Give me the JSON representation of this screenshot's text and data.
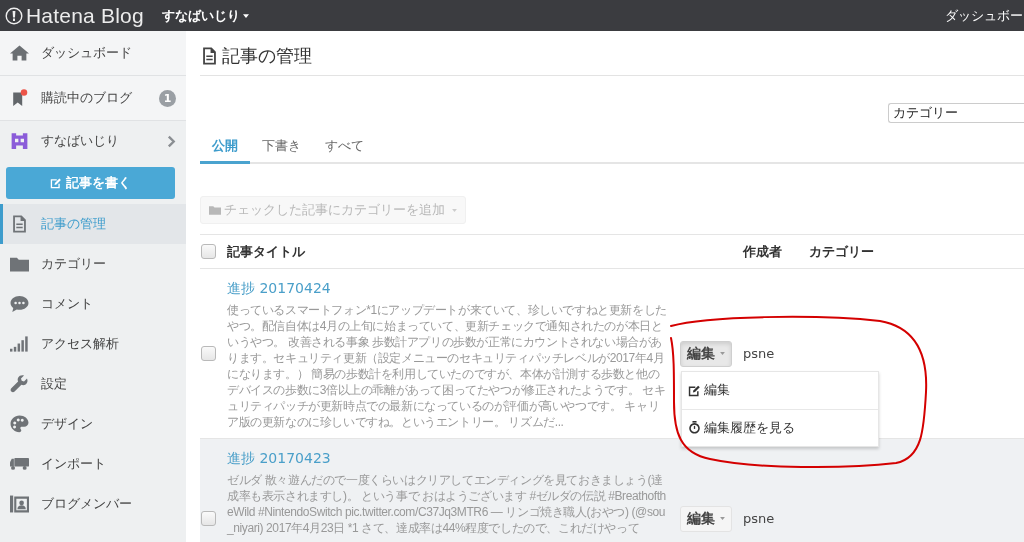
{
  "top_bar": {
    "logo": "Hatena Blog",
    "blog_menu": "すなばいじり",
    "right_link": "ダッシュボー"
  },
  "sidebar": {
    "top_items": [
      {
        "kind": "link",
        "label": "ダッシュボード",
        "unread": false
      },
      {
        "kind": "link",
        "label": "購読中のブログ",
        "badge": "1",
        "unread": true
      },
      {
        "kind": "submenu",
        "label": "すなばいじり",
        "unread": false
      }
    ],
    "write_button": {
      "label": "記事を書く"
    },
    "nav_items": [
      {
        "label": "記事の管理",
        "selected": true
      },
      {
        "label": "カテゴリー",
        "selected": false
      },
      {
        "label": "コメント",
        "selected": false
      },
      {
        "label": "アクセス解析",
        "selected": false
      },
      {
        "label": "設定",
        "selected": false
      },
      {
        "label": "デザイン",
        "selected": false
      },
      {
        "label": "インポート",
        "selected": false
      },
      {
        "label": "ブログメンバー",
        "selected": false
      }
    ]
  },
  "page": {
    "title": "記事の管理",
    "category_filter": {
      "value": "カテゴリー"
    },
    "tabs": [
      {
        "label": "公開",
        "selected": true
      },
      {
        "label": "下書き",
        "selected": false
      },
      {
        "label": "すべて",
        "selected": false
      }
    ],
    "bulk_button": {
      "label": "チェックした記事にカテゴリーを追加",
      "disabled": true
    },
    "table": {
      "select_all": {
        "checked": false
      },
      "columns": [
        "記事タイトル",
        "作成者",
        "カテゴリー"
      ],
      "rows": [
        {
          "title": "進捗 20170424",
          "excerpt": "使っているスマートフォン*1にアップデートが来ていて、珍しいですねと更新をしたやつ。配信自体は4月の上旬に始まっていて、更新チェックで通知されたのが本日というやつ。 改善される事象 歩数計アプリの歩数が正常にカウントされない場合があります。セキュリティ更新（設定メニューのセキュリティパッチレベルが2017年4月になります。） 簡易の歩数計を利用していたのですが、本体が計測する歩数と他のデバイスの歩数に3倍以上の乖離があって困ってたやつが修正されたようです。 セキュリティパッチが更新時点での最新になっているのが評価が高いやつです。 キャリア版の更新なのに珍しいですね。というエントリー。 リズムだ...",
          "checked": false,
          "highlighted": false,
          "author": "psne",
          "edit_menu": {
            "label": "編集",
            "expanded": true,
            "items": [
              {
                "label": "編集"
              },
              {
                "label": "編集履歴を見る"
              }
            ]
          }
        },
        {
          "title": "進捗 20170423",
          "excerpt": "ゼルダ 散々遊んだので一度くらいはクリアしてエンディングを見ておきましょう(達成率も表示されますし)。 という事で おはようございます #ゼルダの伝説 #BreathoftheWild #NintendoSwitch pic.twitter.com/C37Jq3MTR6 — リンゴ焼き職人(おやつ) (@sou_niyari) 2017年4月23日 *1 さて、達成率は44%程度でしたので、これだけやって",
          "checked": false,
          "highlighted": true,
          "author": "psne",
          "edit_menu": {
            "label": "編集",
            "expanded": false
          }
        }
      ]
    }
  },
  "annotation": {
    "kind": "freehand-loop"
  }
}
